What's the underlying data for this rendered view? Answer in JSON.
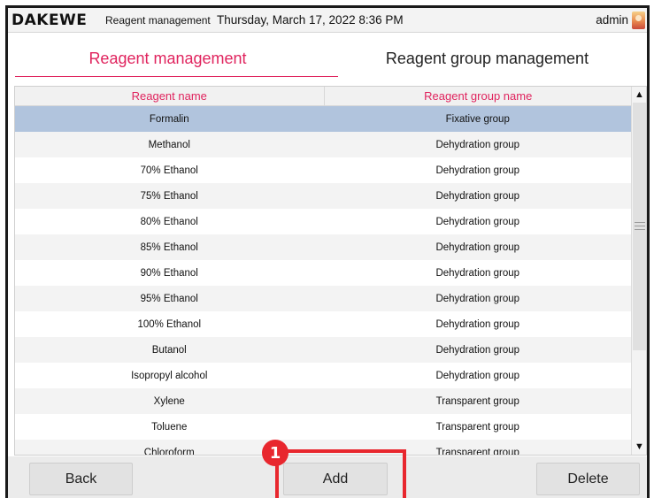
{
  "topbar": {
    "logo": "DAKEWE",
    "module": "Reagent management",
    "datetime": "Thursday, March 17, 2022 8:36 PM",
    "user": "admin"
  },
  "tabs": [
    {
      "label": "Reagent management",
      "active": true
    },
    {
      "label": "Reagent group management",
      "active": false
    }
  ],
  "table": {
    "headers": [
      "Reagent name",
      "Reagent group name"
    ],
    "rows": [
      {
        "name": "Formalin",
        "group": "Fixative group",
        "selected": true
      },
      {
        "name": "Methanol",
        "group": "Dehydration group"
      },
      {
        "name": "70% Ethanol",
        "group": "Dehydration group"
      },
      {
        "name": "75% Ethanol",
        "group": "Dehydration group"
      },
      {
        "name": "80% Ethanol",
        "group": "Dehydration group"
      },
      {
        "name": "85% Ethanol",
        "group": "Dehydration group"
      },
      {
        "name": "90% Ethanol",
        "group": "Dehydration group"
      },
      {
        "name": "95% Ethanol",
        "group": "Dehydration group"
      },
      {
        "name": "100% Ethanol",
        "group": "Dehydration group"
      },
      {
        "name": "Butanol",
        "group": "Dehydration group"
      },
      {
        "name": "Isopropyl alcohol",
        "group": "Dehydration group"
      },
      {
        "name": "Xylene",
        "group": "Transparent group"
      },
      {
        "name": "Toluene",
        "group": "Transparent group"
      },
      {
        "name": "Chloroform",
        "group": "Transparent group"
      }
    ]
  },
  "buttons": {
    "back": "Back",
    "add": "Add",
    "delete": "Delete"
  },
  "annotation": {
    "marker": "1"
  },
  "icons": {
    "scroll_up": "triangle-up-icon",
    "scroll_down": "triangle-down-icon",
    "user": "user-avatar-icon"
  },
  "colors": {
    "accent": "#e0245e",
    "selected_row": "#b1c4dd",
    "highlight": "#e8272e"
  }
}
